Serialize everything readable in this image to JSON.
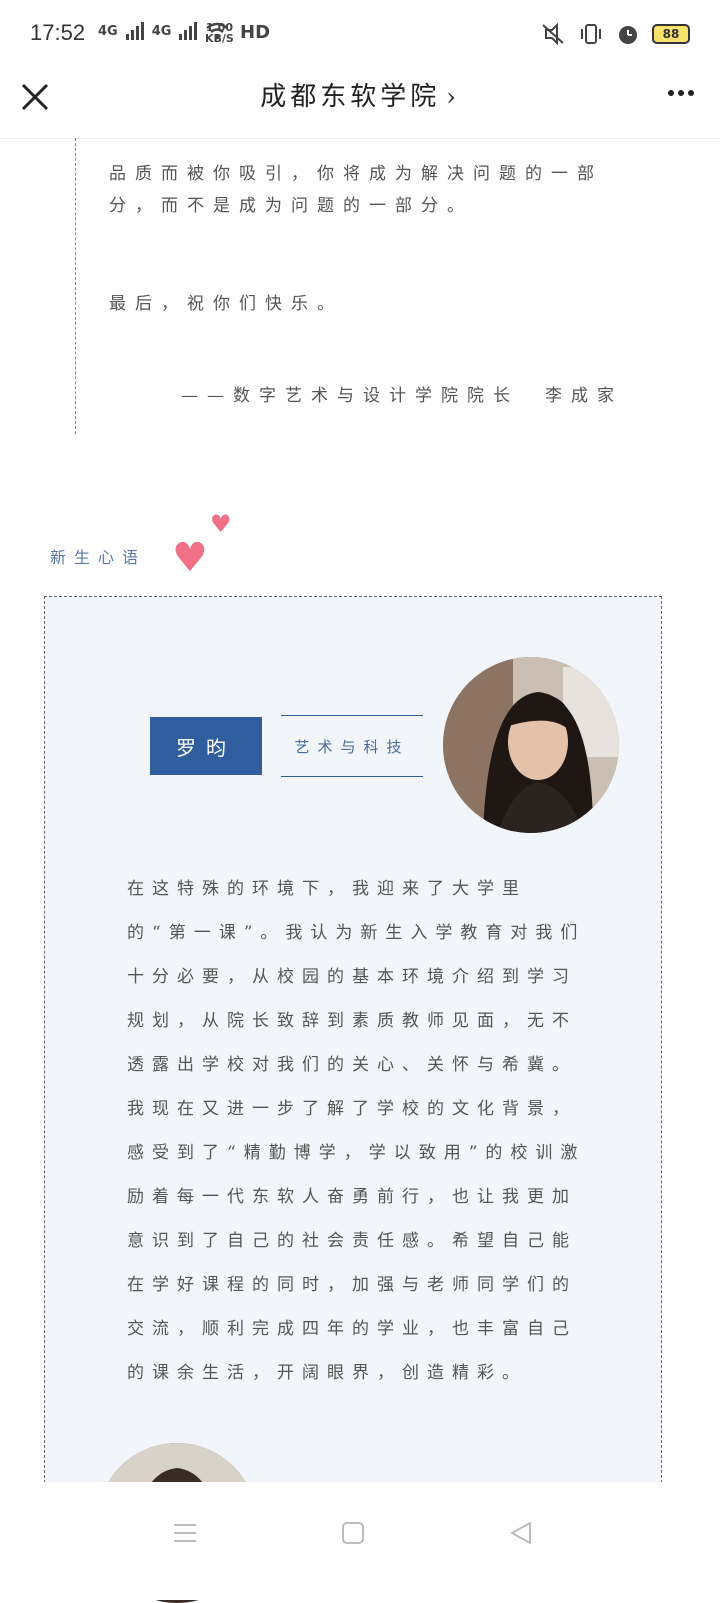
{
  "status_bar": {
    "time": "17:52",
    "net1": "4G",
    "net2": "4G",
    "speed_value": "1.00",
    "speed_unit": "KB/S",
    "hd": "HD",
    "battery": "88",
    "battery_color": "#f7e36b"
  },
  "nav": {
    "title": "成都东软学院"
  },
  "quote": {
    "p1": "品质而被你吸引，你将成为解决问题的一部分，而不是成为问题的一部分。",
    "p2": "最后，祝你们快乐。",
    "p3": "——数字艺术与设计学院院长　李成家"
  },
  "section": {
    "title": "新生心语"
  },
  "profile": {
    "name": "罗昀",
    "major": "艺术与科技",
    "text": "在这特殊的环境下，我迎来了大学里的“第一课”。我认为新生入学教育对我们十分必要，从校园的基本环境介绍到学习规划，从院长致辞到素质教师见面，无不透露出学校对我们的关心、关怀与希冀。我现在又进一步了解了学校的文化背景，感受到了“精勤博学，学以致用”的校训激励着每一代东软人奋勇前行，也让我更加意识到了自己的社会责任感。希望自己能在学好课程的同时，加强与老师同学们的交流，顺利完成四年的学业，也丰富自己的课余生活，开阔眼界，创造精彩。",
    "accent": "#2f5d9e"
  }
}
